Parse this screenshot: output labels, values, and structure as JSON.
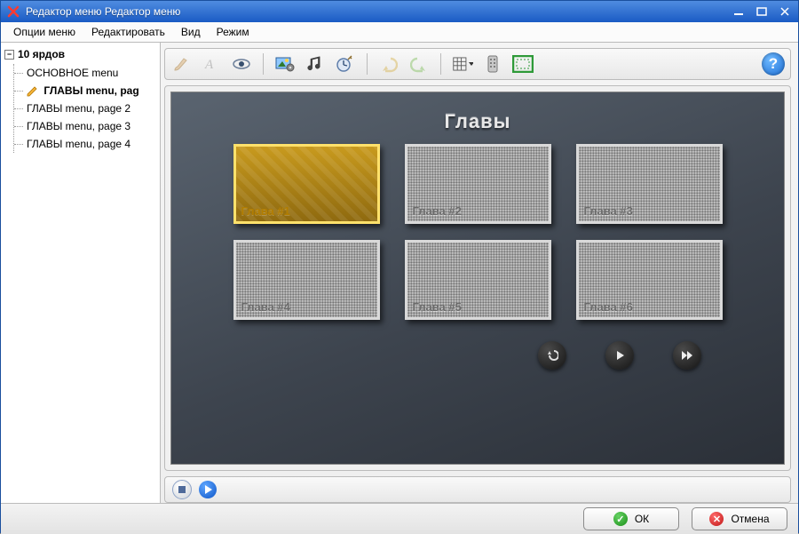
{
  "window": {
    "title": "Редактор меню Редактор меню"
  },
  "menubar": {
    "options": "Опции меню",
    "edit": "Редактировать",
    "view": "Вид",
    "mode": "Режим"
  },
  "tree": {
    "root": "10 ярдов",
    "items": [
      {
        "label": "ОСНОВНОЕ menu",
        "selected": false
      },
      {
        "label": "ГЛАВЫ menu, pag",
        "selected": true
      },
      {
        "label": "ГЛАВЫ menu, page 2",
        "selected": false
      },
      {
        "label": "ГЛАВЫ menu, page 3",
        "selected": false
      },
      {
        "label": "ГЛАВЫ menu, page 4",
        "selected": false
      }
    ]
  },
  "toolbar": {
    "help": "?"
  },
  "dvd": {
    "title": "Главы",
    "chapters": [
      {
        "label": "Глава #1",
        "selected": true
      },
      {
        "label": "Глава #2",
        "selected": false
      },
      {
        "label": "Глава #3",
        "selected": false
      },
      {
        "label": "Глава #4",
        "selected": false
      },
      {
        "label": "Глава #5",
        "selected": false
      },
      {
        "label": "Глава #6",
        "selected": false
      }
    ]
  },
  "footer": {
    "ok": "ОК",
    "cancel": "Отмена"
  }
}
